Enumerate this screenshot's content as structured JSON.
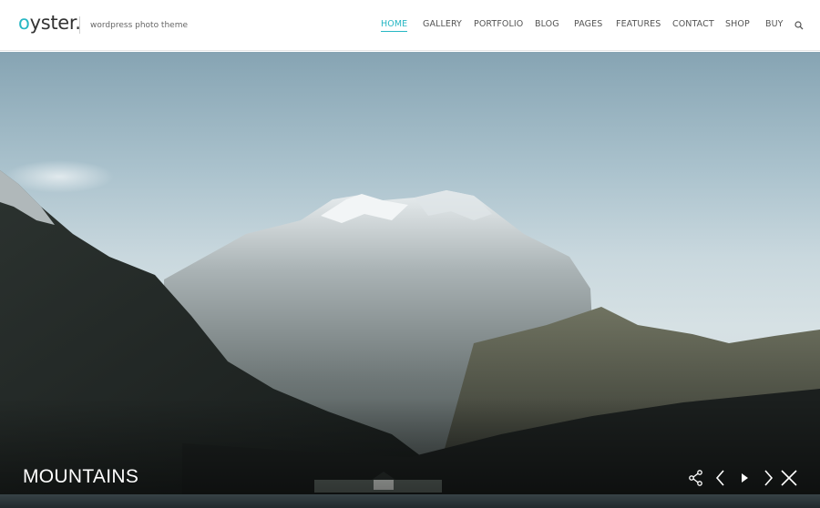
{
  "brand": {
    "logo_first": "o",
    "logo_rest": "yster.",
    "tagline": "wordpress photo theme",
    "accent_color": "#27b7c4"
  },
  "nav": {
    "items": [
      {
        "label": "HOME",
        "active": true
      },
      {
        "label": "GALLERY",
        "active": false
      },
      {
        "label": "PORTFOLIO",
        "active": false
      },
      {
        "label": "BLOG",
        "active": false
      },
      {
        "label": "PAGES",
        "active": false
      },
      {
        "label": "FEATURES",
        "active": false
      },
      {
        "label": "CONTACT",
        "active": false
      },
      {
        "label": "SHOP",
        "active": false
      },
      {
        "label": "BUY",
        "active": false
      }
    ],
    "search_icon": "search-icon"
  },
  "slide": {
    "title": "MOUNTAINS",
    "image_description": "Snow-capped mountain above a forested valley and a lake with a white house"
  },
  "controls": {
    "icons": [
      "share-icon",
      "previous-icon",
      "play-icon",
      "next-icon",
      "close-icon"
    ]
  }
}
